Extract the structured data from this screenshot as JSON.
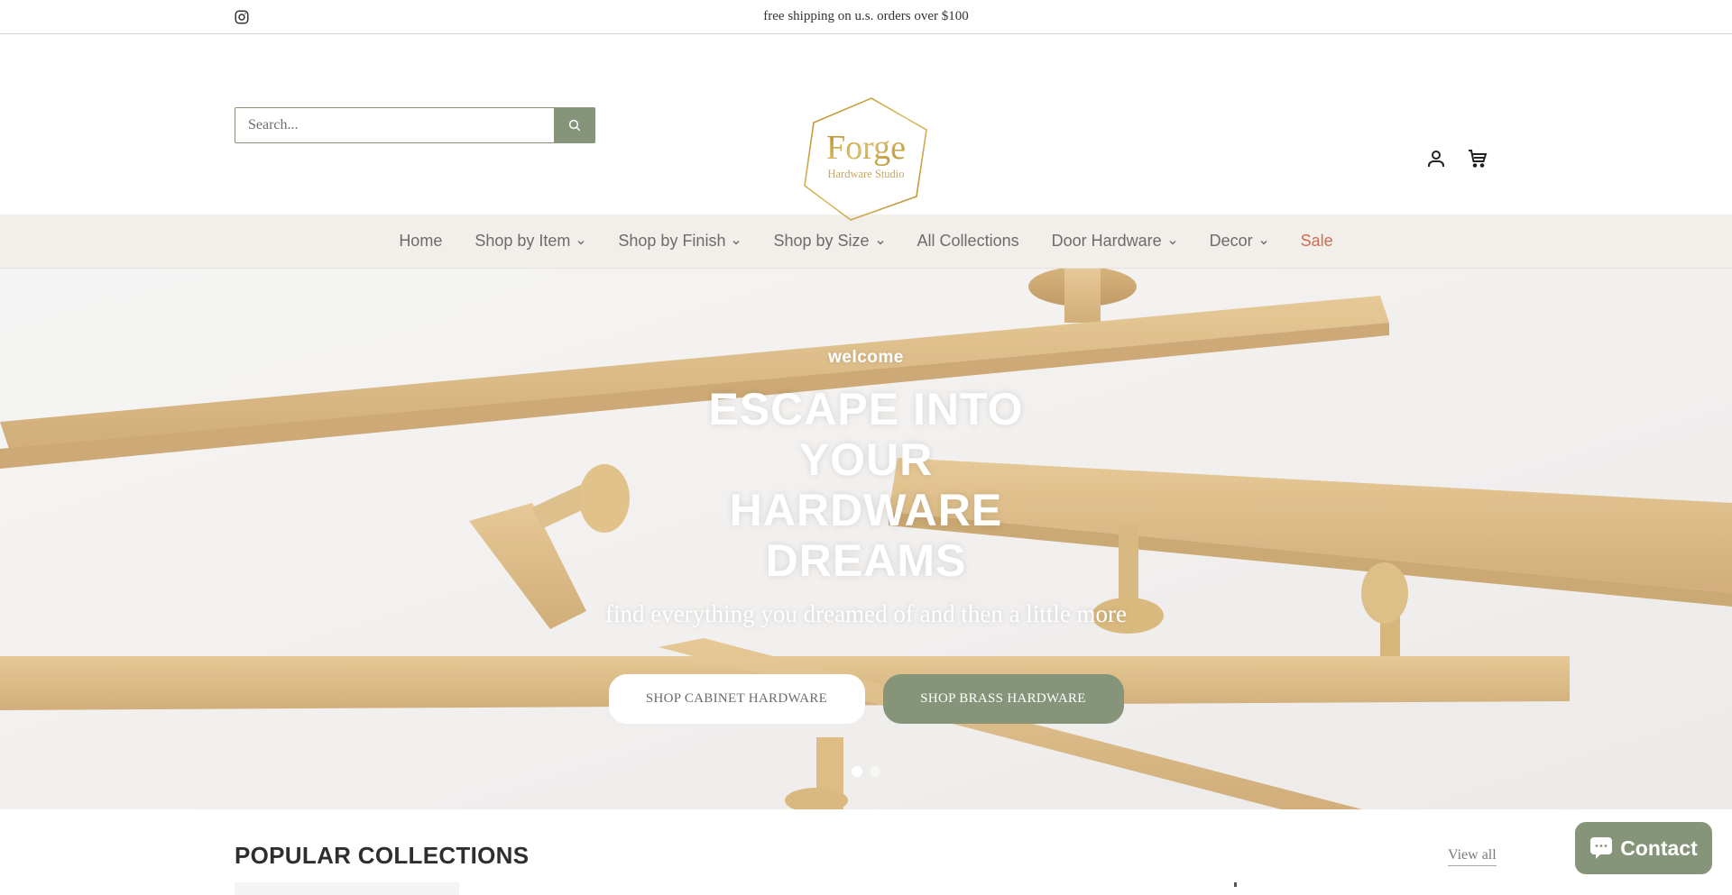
{
  "announcement": {
    "social_icon": "instagram-icon",
    "message": "free shipping on u.s. orders over $100"
  },
  "header": {
    "search": {
      "placeholder": "Search...",
      "value": "",
      "button_icon": "search-icon"
    },
    "logo": {
      "title": "Forge",
      "subtitle": "Hardware Studio"
    },
    "icons": [
      "account-icon",
      "cart-icon"
    ]
  },
  "nav": {
    "items": [
      {
        "label": "Home",
        "dropdown": false
      },
      {
        "label": "Shop by Item",
        "dropdown": true
      },
      {
        "label": "Shop by Finish",
        "dropdown": true
      },
      {
        "label": "Shop by Size",
        "dropdown": true
      },
      {
        "label": "All Collections",
        "dropdown": false
      },
      {
        "label": "Door Hardware",
        "dropdown": true
      },
      {
        "label": "Decor",
        "dropdown": true
      },
      {
        "label": "Sale",
        "dropdown": false
      }
    ]
  },
  "hero": {
    "eyebrow": "welcome",
    "headline": "ESCAPE INTO YOUR HARDWARE DREAMS",
    "subheading": "find everything you dreamed of and then a little more",
    "buttons": [
      {
        "label": "SHOP CABINET HARDWARE"
      },
      {
        "label": "SHOP BRASS HARDWARE"
      }
    ],
    "slides": {
      "count": 2,
      "active": 1
    }
  },
  "popular": {
    "title": "POPULAR COLLECTIONS",
    "view_all": "View all"
  },
  "contact_widget": {
    "label": "Contact",
    "icon": "chat-bubble-icon"
  },
  "colors": {
    "accent_green": "#86957a",
    "sale_red": "#d46a4e",
    "nav_bg": "#f2eeea",
    "logo_gold": "#c9a23c"
  }
}
